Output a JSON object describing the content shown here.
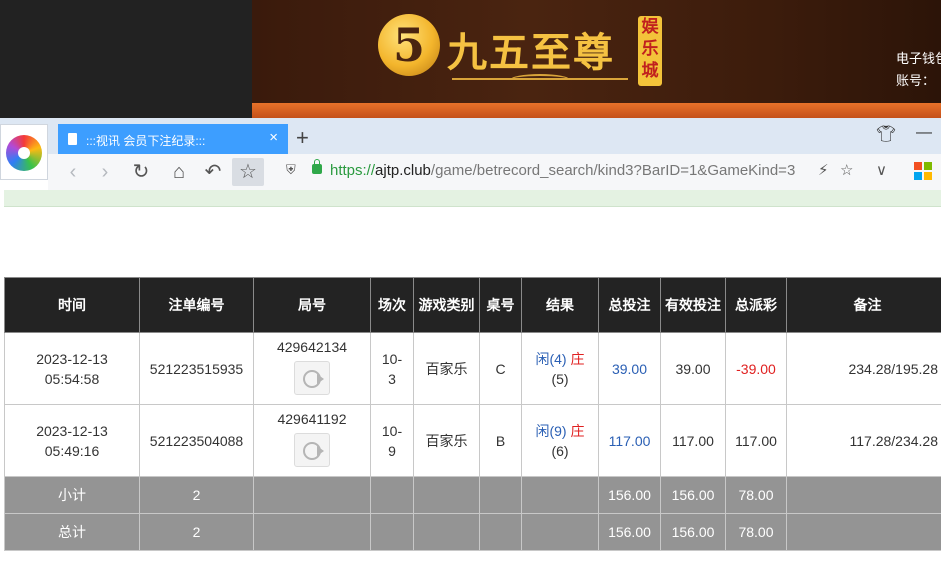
{
  "banner": {
    "logo_mark": "5",
    "logo_text": "九五至尊",
    "badge": [
      "娱",
      "乐",
      "城"
    ],
    "info_line1": "电子钱包",
    "info_line2": "账号："
  },
  "browser": {
    "tab_title": ":::视讯 会员下注纪录:::",
    "tab_close": "×",
    "new_tab": "+",
    "url_proto": "https://",
    "url_host": "ajtp.club",
    "url_path": "/game/betrecord_search/kind3?BarID=1&GameKind=3"
  },
  "table": {
    "headers": [
      "时间",
      "注单编号",
      "局号",
      "场次",
      "游戏类别",
      "桌号",
      "结果",
      "总投注",
      "有效投注",
      "总派彩",
      "备注"
    ],
    "rows": [
      {
        "time_date": "2023-12-13",
        "time_clock": "05:54:58",
        "order_no": "521223515935",
        "round_no": "429642134",
        "session_a": "10-",
        "session_b": "3",
        "game": "百家乐",
        "table": "C",
        "result_player": "闲(4)",
        "result_banker": "庄",
        "result_banker_score": "(5)",
        "total_bet": "39.00",
        "valid_bet": "39.00",
        "payout": "-39.00",
        "note": "234.28/195.28"
      },
      {
        "time_date": "2023-12-13",
        "time_clock": "05:49:16",
        "order_no": "521223504088",
        "round_no": "429641192",
        "session_a": "10-",
        "session_b": "9",
        "game": "百家乐",
        "table": "B",
        "result_player": "闲(9)",
        "result_banker": "庄",
        "result_banker_score": "(6)",
        "total_bet": "117.00",
        "valid_bet": "117.00",
        "payout": "117.00",
        "note": "117.28/234.28"
      }
    ],
    "subtotal": {
      "label": "小计",
      "count": "2",
      "total_bet": "156.00",
      "valid_bet": "156.00",
      "payout": "78.00"
    },
    "grandtotal": {
      "label": "总计",
      "count": "2",
      "total_bet": "156.00",
      "valid_bet": "156.00",
      "payout": "78.00"
    }
  },
  "colors": {
    "header_bg": "#232323",
    "sum_bg": "#949494",
    "tab_blue": "#3d9eff",
    "link_blue": "#2a5fb4",
    "negative_red": "#e02020"
  }
}
